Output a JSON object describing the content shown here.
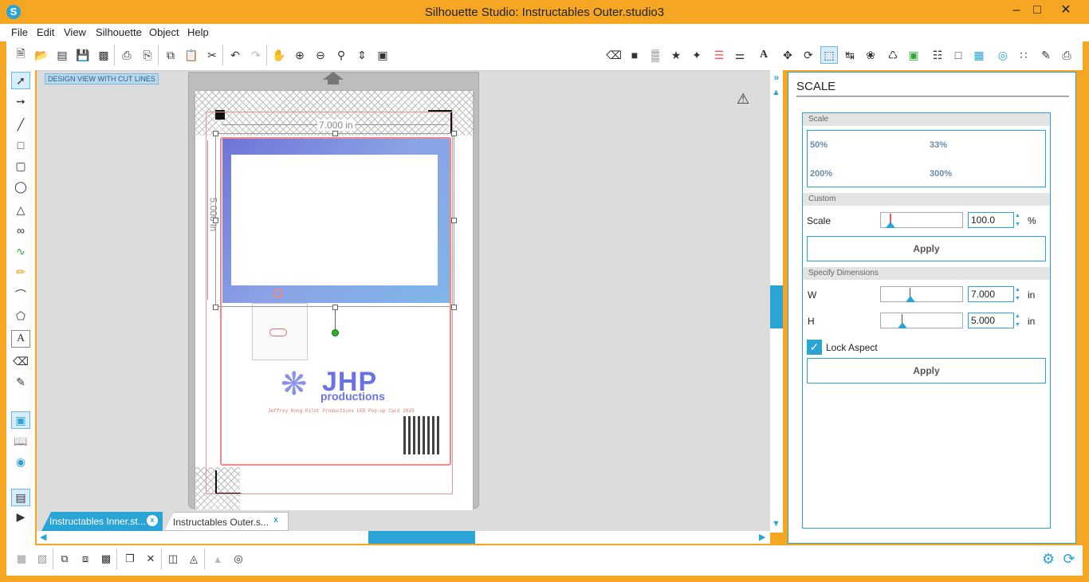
{
  "window": {
    "title": "Silhouette Studio: Instructables Outer.studio3",
    "logo": "S"
  },
  "menu": [
    "File",
    "Edit",
    "View",
    "Silhouette",
    "Object",
    "Help"
  ],
  "canvas": {
    "view_label": "DESIGN VIEW WITH CUT LINES",
    "width_dim": "7.000 in",
    "height_dim": "5.000 in"
  },
  "artwork": {
    "logo_big": "JHP",
    "logo_small": "productions",
    "footer_text": "Jeffrey Hong Pilot Productions LED Pop-up Card 2015"
  },
  "tabs": [
    {
      "label": "Instructables Inner.st...",
      "close": "x"
    },
    {
      "label": "Instructables Outer.s...",
      "close": "x"
    }
  ],
  "panel": {
    "title": "SCALE",
    "scale_section": "Scale",
    "presets": [
      "50%",
      "33%",
      "200%",
      "300%"
    ],
    "custom_section": "Custom",
    "scale_label": "Scale",
    "scale_value": "100.0",
    "scale_unit": "%",
    "apply1": "Apply",
    "dims_section": "Specify Dimensions",
    "w_label": "W",
    "w_value": "7.000",
    "h_label": "H",
    "h_value": "5.000",
    "dim_unit": "in",
    "lock_label": "Lock Aspect",
    "lock_checked": true,
    "apply2": "Apply"
  },
  "colors": {
    "accent": "#2aa3d5",
    "titlebar": "#f5a623",
    "cutline": "#f08a8a"
  }
}
